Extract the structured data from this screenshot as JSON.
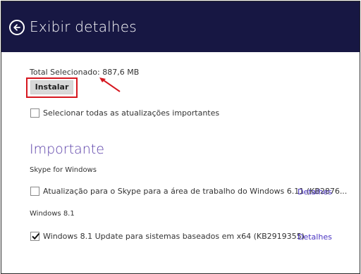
{
  "header": {
    "title": "Exibir detalhes",
    "back_icon": "back-arrow-circle-icon",
    "background": "#171743"
  },
  "summary": {
    "total_label": "Total Selecionado: 887,6 MB"
  },
  "install_button": {
    "label": "Instalar"
  },
  "select_all": {
    "label": "Selecionar todas as atualizações importantes",
    "checked": false
  },
  "section": {
    "title": "Importante",
    "accent": "#5a3fa8"
  },
  "groups": [
    {
      "name": "Skype for Windows",
      "update": {
        "label": "Atualização para o Skype para a área de trabalho do Windows 6.11 (KB2876...",
        "checked": false,
        "details_label": "Detalhes"
      }
    },
    {
      "name": "Windows 8.1",
      "update": {
        "label": "Windows 8.1 Update para sistemas baseados em x64 (KB2919355)",
        "checked": true,
        "details_label": "Detalhes"
      }
    }
  ],
  "annotations": {
    "highlight_color": "#d6171f"
  }
}
